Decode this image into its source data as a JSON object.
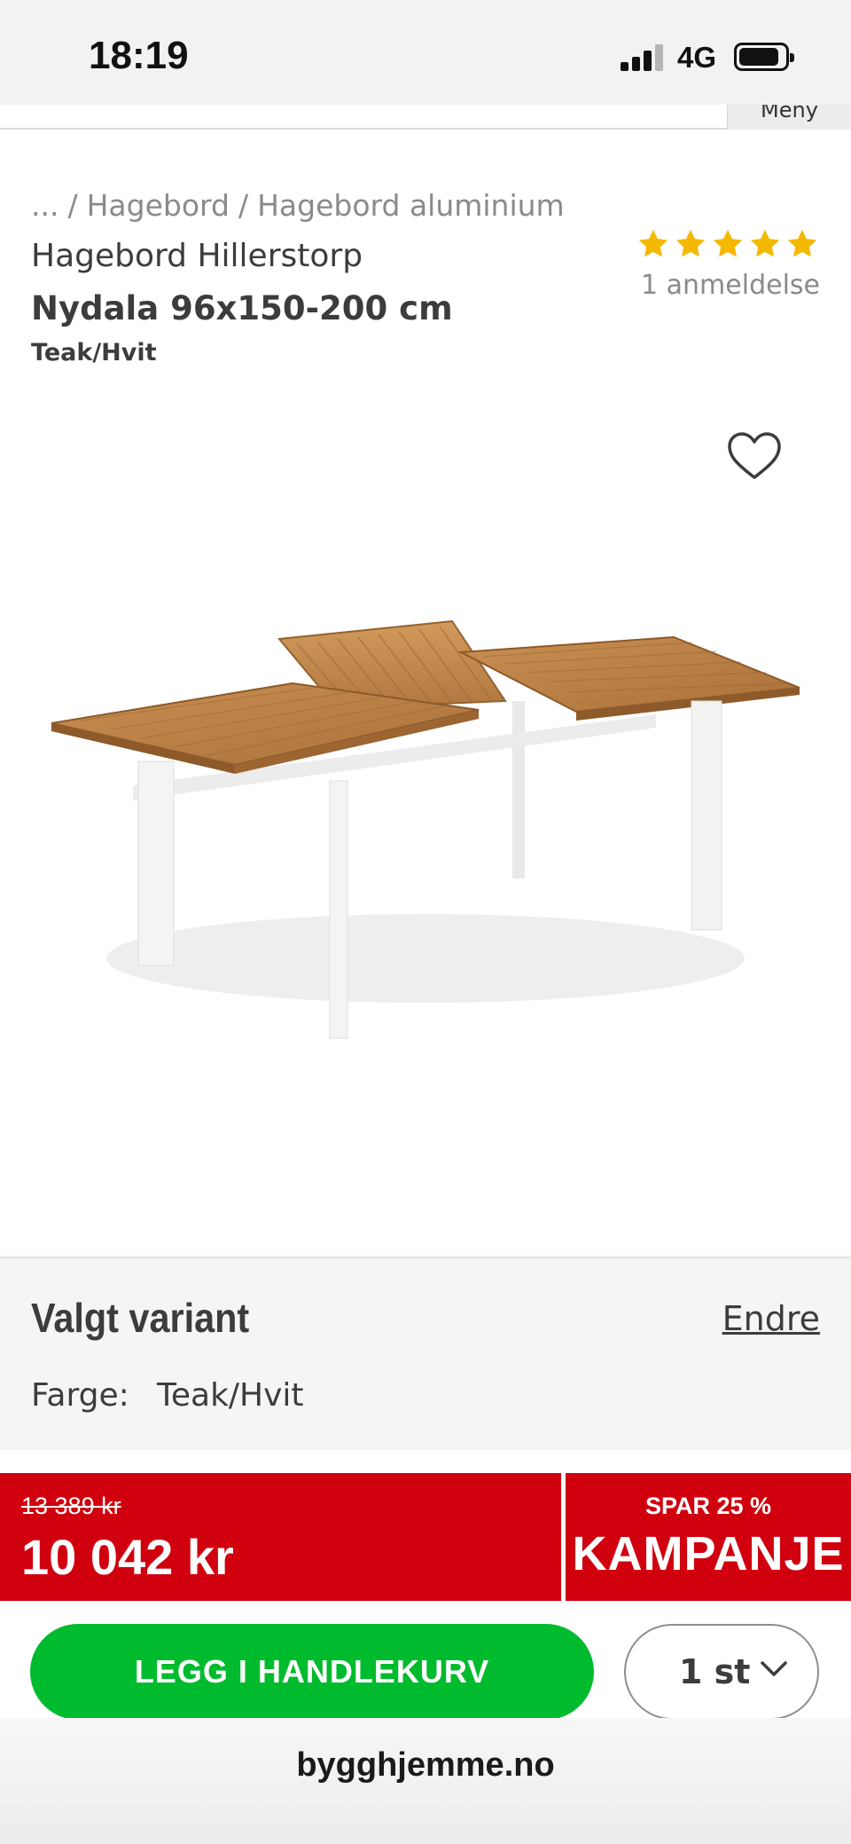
{
  "status_bar": {
    "time": "18:19",
    "network": "4G"
  },
  "header": {
    "menu_label": "Meny"
  },
  "breadcrumb": {
    "items": [
      "...",
      "Hagebord",
      "Hagebord aluminium"
    ],
    "separator": "/"
  },
  "product": {
    "brand_line": "Hagebord Hillerstorp",
    "name": "Nydala 96x150-200 cm",
    "variant": "Teak/Hvit",
    "rating": 5,
    "rating_max": 5,
    "review_count": "1 anmeldelse",
    "star_color": "#f5b800",
    "image": "garden-table-image"
  },
  "variant_section": {
    "title": "Valgt variant",
    "change_link": "Endre",
    "color_label": "Farge:",
    "color_value": "Teak/Hvit"
  },
  "price": {
    "old_price": "13 389 kr",
    "new_price": "10 042 kr",
    "save_text": "SPAR 25 %",
    "campaign_label": "KAMPANJE",
    "bar_color": "#d0000f"
  },
  "cart": {
    "button_label": "LEGG I HANDLEKURV",
    "button_color": "#00bb2d",
    "quantity": "1 st"
  },
  "browser": {
    "url": "bygghjemme.no"
  }
}
